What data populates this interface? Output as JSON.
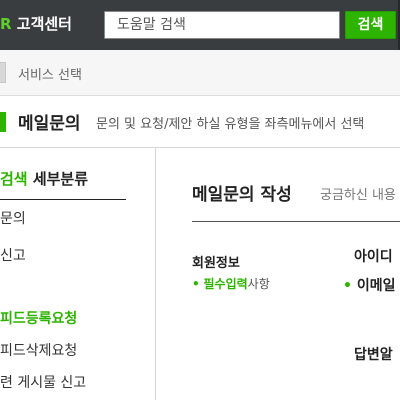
{
  "header": {
    "brand_mark": "R",
    "brand_text": " 고객센터",
    "search_value": "도움말 검색",
    "search_button": "검색"
  },
  "service_bar": {
    "label": "서비스 선택"
  },
  "title_bar": {
    "title": "메일문의",
    "description": "문의 및 요청/제안 하실 유형을 좌측메뉴에서 선택"
  },
  "sidebar": {
    "heading_highlight": "검색",
    "heading_rest": " 세부분류",
    "items": [
      {
        "label": "문의"
      },
      {
        "label": "신고"
      },
      {
        "label": "피드등록요청"
      },
      {
        "label": "피드삭제요청"
      },
      {
        "label": "련 게시물 신고"
      }
    ]
  },
  "main": {
    "title": "메일문의 작성",
    "subtitle": "궁금하신 내용",
    "section_label": "회원정보",
    "required_bullet": "•",
    "required_strong": "필수입력",
    "required_rest": "사항",
    "fields": [
      {
        "label": "아이디"
      },
      {
        "label": "이메일"
      },
      {
        "label": "답변알"
      }
    ],
    "field_bullet": "•"
  },
  "colors": {
    "accent": "#2db400",
    "header_bg": "#3a3d40"
  }
}
